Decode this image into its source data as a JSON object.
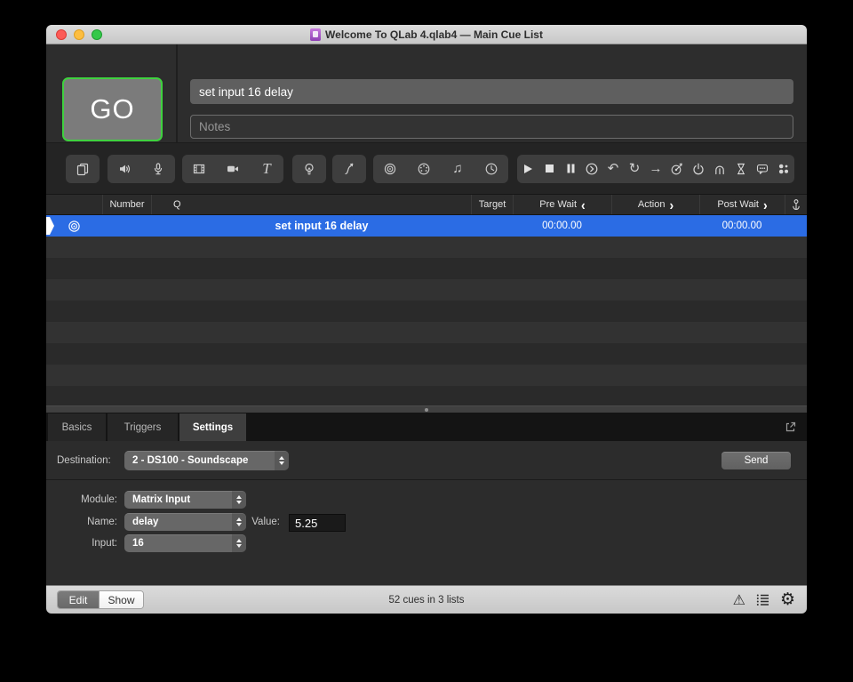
{
  "window": {
    "title": "Welcome To QLab 4.qlab4 — Main Cue List"
  },
  "header": {
    "go_label": "GO",
    "cue_name": "set input 16 delay",
    "notes_placeholder": "Notes"
  },
  "toolbar": {
    "icon_names": [
      "group-cue",
      "audio-cue",
      "mic-cue",
      "video-cue",
      "camera-cue",
      "text-cue",
      "light-cue",
      "fade-cue",
      "network-cue",
      "midi-cue",
      "midi-file-cue",
      "timecode-cue",
      "start-cue",
      "stop-cue",
      "pause-cue",
      "load-cue",
      "reset-cue",
      "redo-cue",
      "goto-cue",
      "target-cue",
      "arm-cue",
      "disarm-cue",
      "wait-cue",
      "memo-cue",
      "script-cue"
    ]
  },
  "cue_list": {
    "columns": {
      "number": "Number",
      "q": "Q",
      "target": "Target",
      "pre_wait": "Pre Wait",
      "action": "Action",
      "post_wait": "Post Wait"
    },
    "row": {
      "type": "network-cue",
      "name": "set input 16 delay",
      "pre_wait": "00:00.00",
      "post_wait": "00:00.00"
    }
  },
  "tabs": [
    {
      "label": "Basics"
    },
    {
      "label": "Triggers"
    },
    {
      "label": "Settings",
      "active": true
    }
  ],
  "inspector": {
    "destination_label": "Destination:",
    "destination_value": "2 - DS100 - Soundscape",
    "send_label": "Send",
    "module_label": "Module:",
    "module_value": "Matrix Input",
    "name_label": "Name:",
    "name_value": "delay",
    "value_label": "Value:",
    "value_value": "5.25",
    "input_label": "Input:",
    "input_value": "16"
  },
  "statusbar": {
    "edit_label": "Edit",
    "show_label": "Show",
    "summary": "52 cues in 3 lists"
  },
  "colors": {
    "selection_blue": "#2b6ce4",
    "go_green": "#3fd13f",
    "row_stripe_light": "#323232",
    "row_stripe_dark": "#2a2a2a"
  }
}
